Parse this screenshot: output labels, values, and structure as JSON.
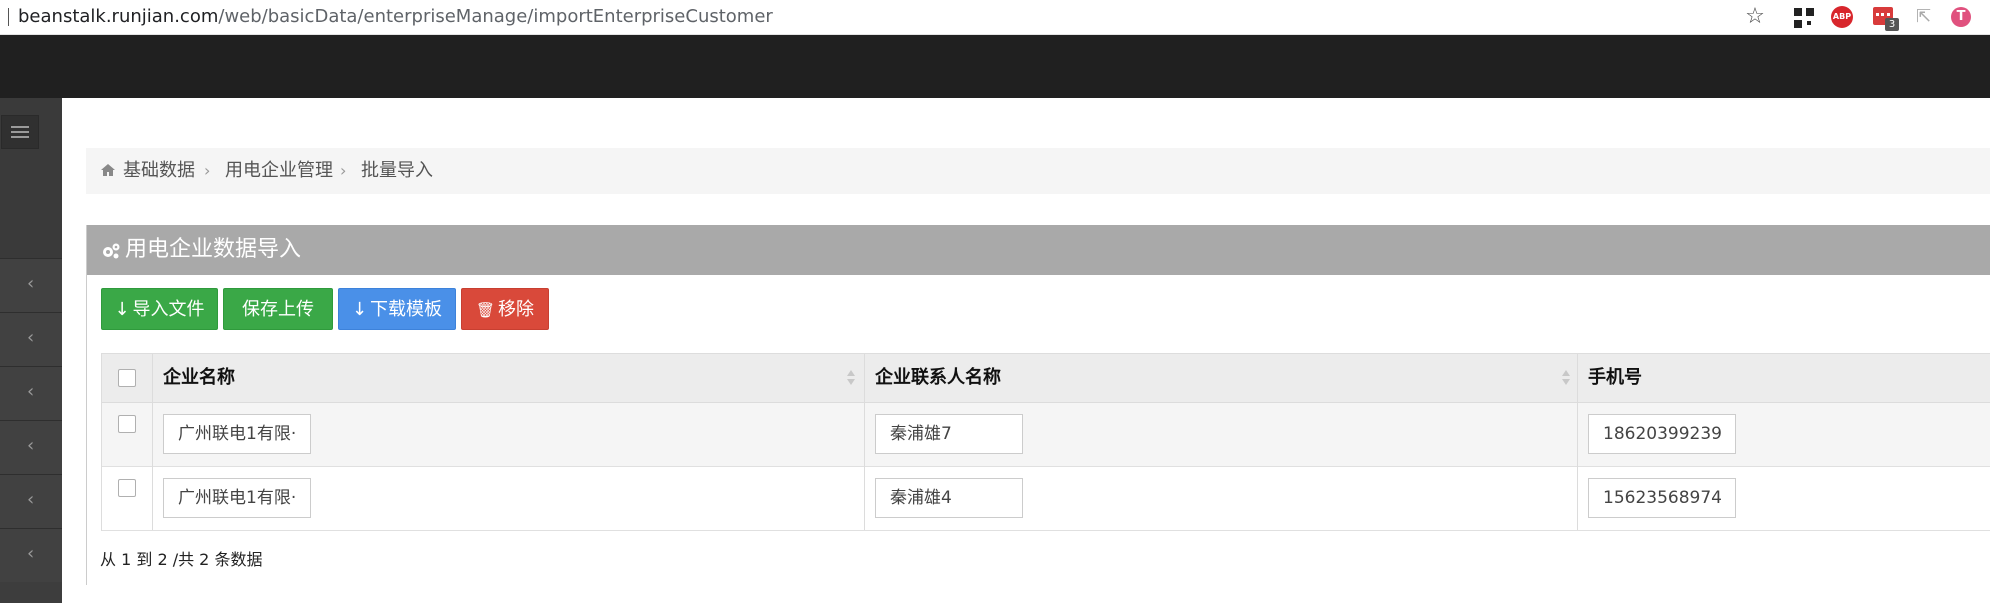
{
  "browser": {
    "url_host": "beanstalk.runjian.com",
    "url_path": "/web/basicData/enterpriseManage/importEnterpriseCustomer",
    "star_icon": "star-icon",
    "extensions": [
      "qr-code-icon",
      "adblock-plus-icon",
      "red-extension-icon",
      "cursor-extension-icon",
      "t-extension-icon"
    ],
    "extension_badge": "3",
    "abp_label": "ABP",
    "t_label": "T"
  },
  "breadcrumb": {
    "items": [
      "基础数据",
      "用电企业管理",
      "批量导入"
    ],
    "separator": "›"
  },
  "panel": {
    "title": "用电企业数据导入"
  },
  "toolbar": {
    "import_label": "导入文件",
    "save_label": "保存上传",
    "download_label": "下载模板",
    "remove_label": "移除"
  },
  "table": {
    "columns": [
      "企业名称",
      "企业联系人名称",
      "手机号"
    ],
    "rows": [
      {
        "company": "广州联电1有限·",
        "contact": "秦浦雄7",
        "phone": "18620399239"
      },
      {
        "company": "广州联电1有限·",
        "contact": "秦浦雄4",
        "phone": "15623568974"
      }
    ]
  },
  "pagination": {
    "info": "从 1 到 2 /共 2 条数据"
  },
  "colors": {
    "green": "#3aa847",
    "blue": "#4a90e8",
    "red": "#d9493a",
    "panel_header": "#a9a9a9",
    "topbar": "#202020",
    "sidebar": "#3d3d3d"
  }
}
